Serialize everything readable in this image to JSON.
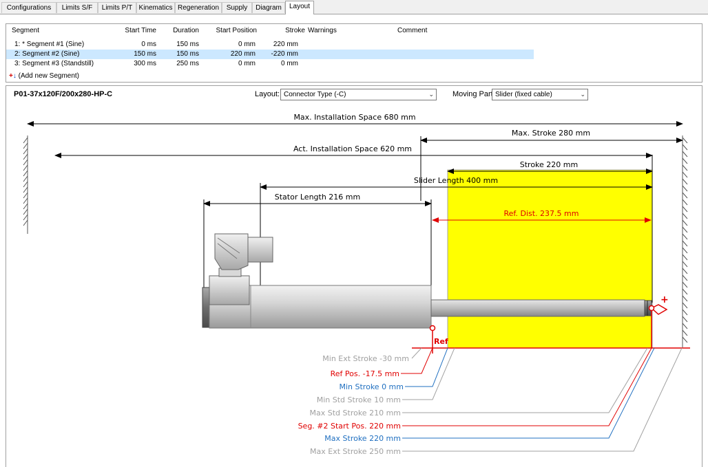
{
  "tabs": [
    {
      "label": "Configurations"
    },
    {
      "label": "Limits S/F"
    },
    {
      "label": "Limits P/T"
    },
    {
      "label": "Kinematics"
    },
    {
      "label": "Regeneration"
    },
    {
      "label": "Supply"
    },
    {
      "label": "Diagram"
    },
    {
      "label": "Layout"
    }
  ],
  "grid": {
    "headers": {
      "segment": "Segment",
      "start_time": "Start Time",
      "duration": "Duration",
      "start_position": "Start Position",
      "stroke": "Stroke",
      "warnings": "Warnings",
      "comment": "Comment"
    },
    "rows": [
      {
        "segment": "1: * Segment #1 (Sine)",
        "start_time": "0 ms",
        "duration": "150 ms",
        "start_position": "0 mm",
        "stroke": "220 mm"
      },
      {
        "segment": "2: Segment #2 (Sine)",
        "start_time": "150 ms",
        "duration": "150 ms",
        "start_position": "220 mm",
        "stroke": "-220 mm"
      },
      {
        "segment": "3: Segment #3 (Standstill)",
        "start_time": "300 ms",
        "duration": "250 ms",
        "start_position": "0 mm",
        "stroke": "0 mm"
      }
    ],
    "add_label": "(Add new Segment)"
  },
  "layout": {
    "title": "P01-37x120F/200x280-HP-C",
    "layout_label": "Layout:",
    "layout_value": "Connector Type (-C)",
    "moving_label": "Moving Part:",
    "moving_value": "Slider (fixed cable)"
  },
  "dims": {
    "max_install": "Max. Installation Space 680 mm",
    "max_stroke": "Max. Stroke 280 mm",
    "act_install": "Act. Installation Space 620 mm",
    "stroke": "Stroke 220 mm",
    "slider_length": "Slider Length 400 mm",
    "stator_length": "Stator Length 216 mm",
    "ref_dist": "Ref. Dist. 237.5 mm",
    "ref": "Ref",
    "plus": "+"
  },
  "callouts": [
    {
      "text": "Min Ext Stroke -30 mm",
      "color": "#a0a0a0"
    },
    {
      "text": "Ref Pos. -17.5 mm",
      "color": "#e00000"
    },
    {
      "text": "Min Stroke 0 mm",
      "color": "#1f6fc0"
    },
    {
      "text": "Min Std Stroke 10 mm",
      "color": "#a0a0a0"
    },
    {
      "text": "Max Std Stroke 210 mm",
      "color": "#a0a0a0"
    },
    {
      "text": "Seg. #2 Start Pos. 220 mm",
      "color": "#e00000"
    },
    {
      "text": "Max Stroke 220 mm",
      "color": "#1f6fc0"
    },
    {
      "text": "Max Ext Stroke 250 mm",
      "color": "#a0a0a0"
    }
  ],
  "colors": {
    "stroke_zone": "#ffff00",
    "reference": "#e00000",
    "limit_blue": "#1f6fc0",
    "limit_gray": "#a0a0a0"
  }
}
